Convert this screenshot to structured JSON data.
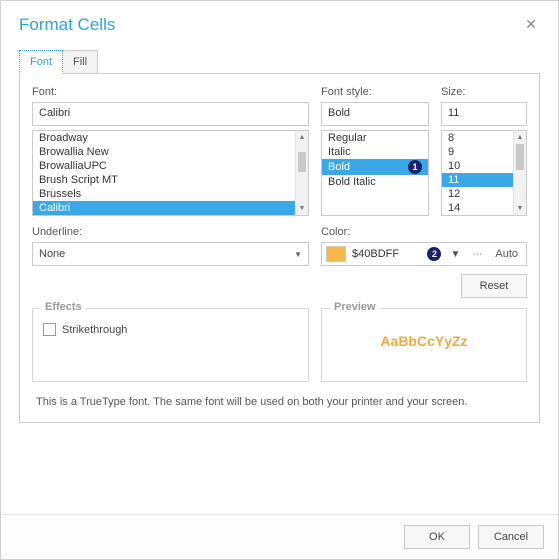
{
  "title": "Format Cells",
  "tabs": {
    "font": "Font",
    "fill": "Fill"
  },
  "font": {
    "label": "Font:",
    "value": "Calibri",
    "options": [
      "Broadway",
      "Browallia New",
      "BrowalliaUPC",
      "Brush Script MT",
      "Brussels",
      "Calibri"
    ]
  },
  "style": {
    "label": "Font style:",
    "value": "Bold",
    "options": [
      "Regular",
      "Italic",
      "Bold",
      "Bold Italic"
    ]
  },
  "size": {
    "label": "Size:",
    "value": "11",
    "options": [
      "8",
      "9",
      "10",
      "11",
      "12",
      "14"
    ]
  },
  "underline": {
    "label": "Underline:",
    "value": "None"
  },
  "color": {
    "label": "Color:",
    "value": "$40BDFF",
    "auto": "Auto",
    "swatch": "#f7b84b"
  },
  "reset": "Reset",
  "effects": {
    "title": "Effects",
    "strikethrough": "Strikethrough"
  },
  "preview": {
    "title": "Preview",
    "sample": "AaBbCcYyZz"
  },
  "footnote": "This is a TrueType font. The same font will be used on both your printer and your screen.",
  "buttons": {
    "ok": "OK",
    "cancel": "Cancel"
  },
  "annotations": {
    "style": "1",
    "color": "2"
  }
}
